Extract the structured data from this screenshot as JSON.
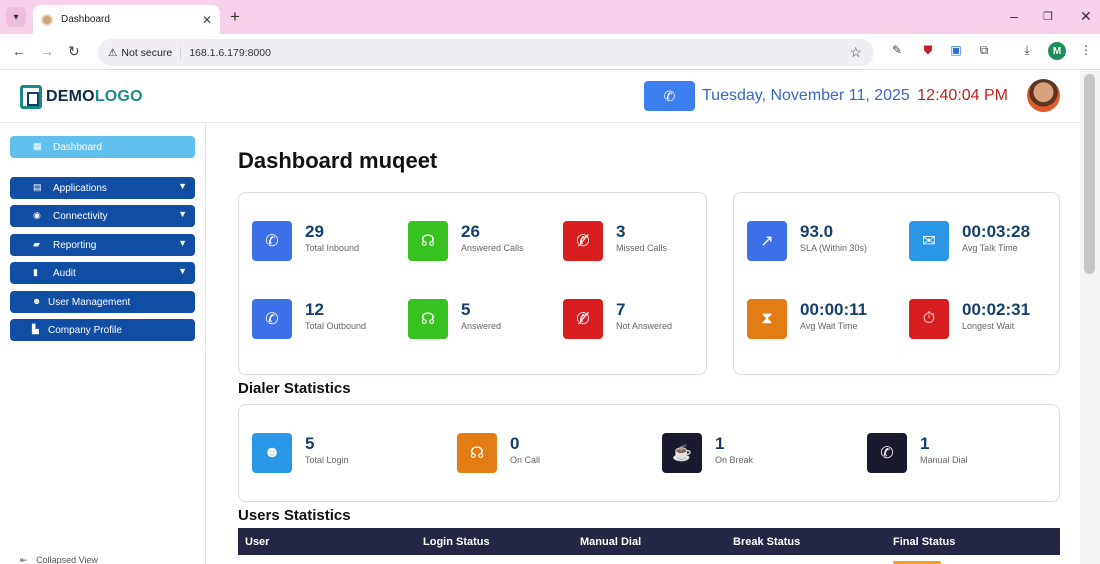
{
  "browser": {
    "tab_title": "Dashboard",
    "url_secure_label": "Not secure",
    "url": "168.1.6.179:8000",
    "profile_initial": "M"
  },
  "header": {
    "logo_prefix": "DEMO",
    "logo_suffix": "LOGO",
    "date": "Tuesday, November 11, 2025",
    "time": "12:40:04 PM"
  },
  "sidebar": {
    "items": [
      {
        "label": "Dashboard",
        "icon": "grid-icon",
        "active": true
      },
      {
        "label": "Applications",
        "icon": "apps-icon",
        "expandable": true
      },
      {
        "label": "Connectivity",
        "icon": "eye-icon",
        "expandable": true
      },
      {
        "label": "Reporting",
        "icon": "folder-icon",
        "expandable": true
      },
      {
        "label": "Audit",
        "icon": "clipboard-icon",
        "expandable": true
      },
      {
        "label": "User Management",
        "icon": "users-icon"
      },
      {
        "label": "Company Profile",
        "icon": "building-icon"
      }
    ],
    "collapse_label": "Collapsed View"
  },
  "main": {
    "title": "Dashboard muqeet",
    "call_stats": [
      {
        "value": "29",
        "label": "Total Inbound",
        "color": "#3d6fe6",
        "icon": "phone-icon"
      },
      {
        "value": "26",
        "label": "Answered Calls",
        "color": "#38c21f",
        "icon": "headset-icon"
      },
      {
        "value": "3",
        "label": "Missed Calls",
        "color": "#d81e1e",
        "icon": "missed-call-icon"
      },
      {
        "value": "12",
        "label": "Total Outbound",
        "color": "#3d6fe6",
        "icon": "phone-icon"
      },
      {
        "value": "5",
        "label": "Answered",
        "color": "#38c21f",
        "icon": "headset-icon"
      },
      {
        "value": "7",
        "label": "Not Answered",
        "color": "#d81e1e",
        "icon": "missed-call-icon"
      }
    ],
    "kpi_stats": [
      {
        "value": "93.0",
        "label": "SLA (Within 30s)",
        "color": "#3d6fe6",
        "icon": "chart-icon"
      },
      {
        "value": "00:03:28",
        "label": "Avg Talk Time",
        "color": "#2a97e6",
        "icon": "chat-icon"
      },
      {
        "value": "00:00:11",
        "label": "Avg Wait Time",
        "color": "#e27d16",
        "icon": "hourglass-icon"
      },
      {
        "value": "00:02:31",
        "label": "Longest Wait",
        "color": "#d81e1e",
        "icon": "stopwatch-icon"
      }
    ],
    "dialer_title": "Dialer Statistics",
    "dialer_stats": [
      {
        "value": "5",
        "label": "Total Login",
        "color": "#2a97e6",
        "icon": "users-icon"
      },
      {
        "value": "0",
        "label": "On Call",
        "color": "#e27d16",
        "icon": "headset-icon"
      },
      {
        "value": "1",
        "label": "On Break",
        "color": "#1a1a2e",
        "icon": "coffee-icon"
      },
      {
        "value": "1",
        "label": "Manual Dial",
        "color": "#1a1a2e",
        "icon": "phone-icon"
      }
    ],
    "users_title": "Users Statistics",
    "users_table_headers": [
      "User",
      "Login Status",
      "Manual Dial",
      "Break Status",
      "Final Status"
    ]
  }
}
